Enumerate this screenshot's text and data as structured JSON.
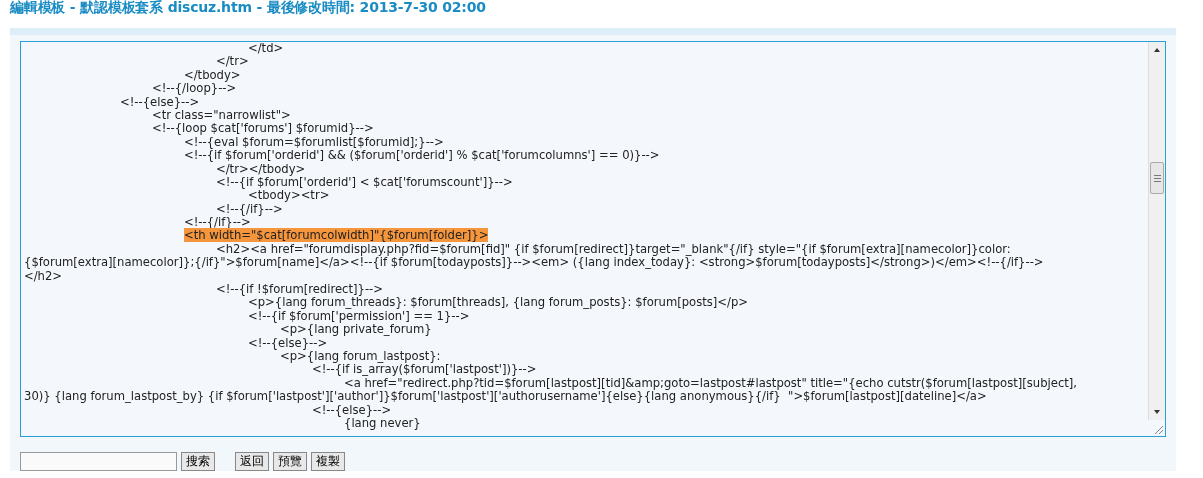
{
  "page_title": "編輯模板 - 默認模板套系 discuz.htm - 最後修改時間: 2013-7-30 02:00",
  "editor": {
    "lines": [
      {
        "text": "\t\t\t\t\t\t\t</td>",
        "selected": false
      },
      {
        "text": "\t\t\t\t\t\t</tr>",
        "selected": false
      },
      {
        "text": "\t\t\t\t\t</tbody>",
        "selected": false
      },
      {
        "text": "\t\t\t\t<!--{/loop}-->",
        "selected": false
      },
      {
        "text": "\t\t\t<!--{else}-->",
        "selected": false
      },
      {
        "text": "\t\t\t\t<tr class=\"narrowlist\">",
        "selected": false
      },
      {
        "text": "\t\t\t\t<!--{loop $cat['forums'] $forumid}-->",
        "selected": false
      },
      {
        "text": "\t\t\t\t\t<!--{eval $forum=$forumlist[$forumid];}-->",
        "selected": false
      },
      {
        "text": "\t\t\t\t\t<!--{if $forum['orderid'] && ($forum['orderid'] % $cat['forumcolumns'] == 0)}-->",
        "selected": false
      },
      {
        "text": "\t\t\t\t\t\t</tr></tbody>",
        "selected": false
      },
      {
        "text": "\t\t\t\t\t\t<!--{if $forum['orderid'] < $cat['forumscount']}-->",
        "selected": false
      },
      {
        "text": "\t\t\t\t\t\t\t<tbody><tr>",
        "selected": false
      },
      {
        "text": "\t\t\t\t\t\t<!--{/if}-->",
        "selected": false
      },
      {
        "text": "\t\t\t\t\t<!--{/if}-->",
        "selected": false
      },
      {
        "text": "\t\t\t\t\t<th width=\"$cat[forumcolwidth]\"{$forum[folder]}>",
        "selected": true
      },
      {
        "text": "\t\t\t\t\t\t<h2><a href=\"forumdisplay.php?fid=$forum[fid]\" {if $forum[redirect]}target=\"_blank\"{/if} style=\"{if $forum[extra][namecolor]}color:",
        "selected": false
      },
      {
        "text": "{$forum[extra][namecolor]};{/if}\">$forum[name]</a><!--{if $forum[todayposts]}--><em> ({lang index_today}: <strong>$forum[todayposts]</strong>)</em><!--{/if}-->",
        "selected": false
      },
      {
        "text": "</h2>",
        "selected": false
      },
      {
        "text": "\t\t\t\t\t\t<!--{if !$forum[redirect]}-->",
        "selected": false
      },
      {
        "text": "\t\t\t\t\t\t\t<p>{lang forum_threads}: $forum[threads], {lang forum_posts}: $forum[posts]</p>",
        "selected": false
      },
      {
        "text": "\t\t\t\t\t\t\t<!--{if $forum['permission'] == 1}-->",
        "selected": false
      },
      {
        "text": "\t\t\t\t\t\t\t\t<p>{lang private_forum}",
        "selected": false
      },
      {
        "text": "\t\t\t\t\t\t\t<!--{else}-->",
        "selected": false
      },
      {
        "text": "\t\t\t\t\t\t\t\t<p>{lang forum_lastpost}:",
        "selected": false
      },
      {
        "text": "\t\t\t\t\t\t\t\t\t<!--{if is_array($forum['lastpost'])}-->",
        "selected": false
      },
      {
        "text": "\t\t\t\t\t\t\t\t\t\t<a href=\"redirect.php?tid=$forum[lastpost][tid]&amp;goto=lastpost#lastpost\" title=\"{echo cutstr($forum[lastpost][subject],",
        "selected": false
      },
      {
        "text": "30)} {lang forum_lastpost_by} {if $forum['lastpost']['author']}$forum['lastpost']['authorusername']{else}{lang anonymous}{/if}  \">$forum[lastpost][dateline]</a>",
        "selected": false
      },
      {
        "text": "\t\t\t\t\t\t\t\t\t<!--{else}-->",
        "selected": false
      },
      {
        "text": "\t\t\t\t\t\t\t\t\t\t{lang never}",
        "selected": false
      }
    ]
  },
  "toolbar": {
    "search_button": "搜索",
    "buttons": [
      "返回",
      "預覽",
      "複製"
    ]
  }
}
